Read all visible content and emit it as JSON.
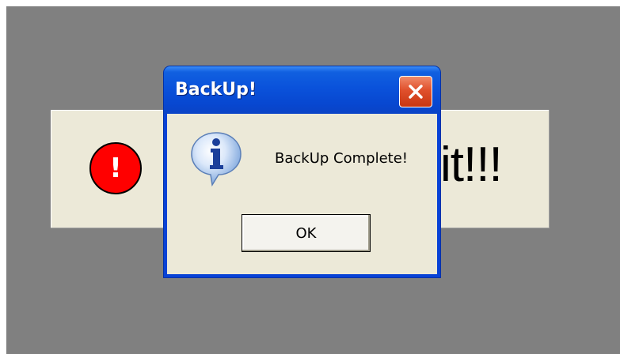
{
  "background_window": {
    "partial_text": "it!!!",
    "alert_glyph": "!",
    "icon": "error-exclamation-icon"
  },
  "dialog": {
    "title": "BackUp!",
    "message": "BackUp Complete!",
    "ok_label": "OK",
    "icon": "information-icon",
    "close_icon": "close-icon"
  },
  "colors": {
    "desktop": "#808080",
    "titlebar": "#0a52db",
    "client": "#ece9d8",
    "close_button": "#e0502c",
    "alert_red": "#ff0000"
  }
}
